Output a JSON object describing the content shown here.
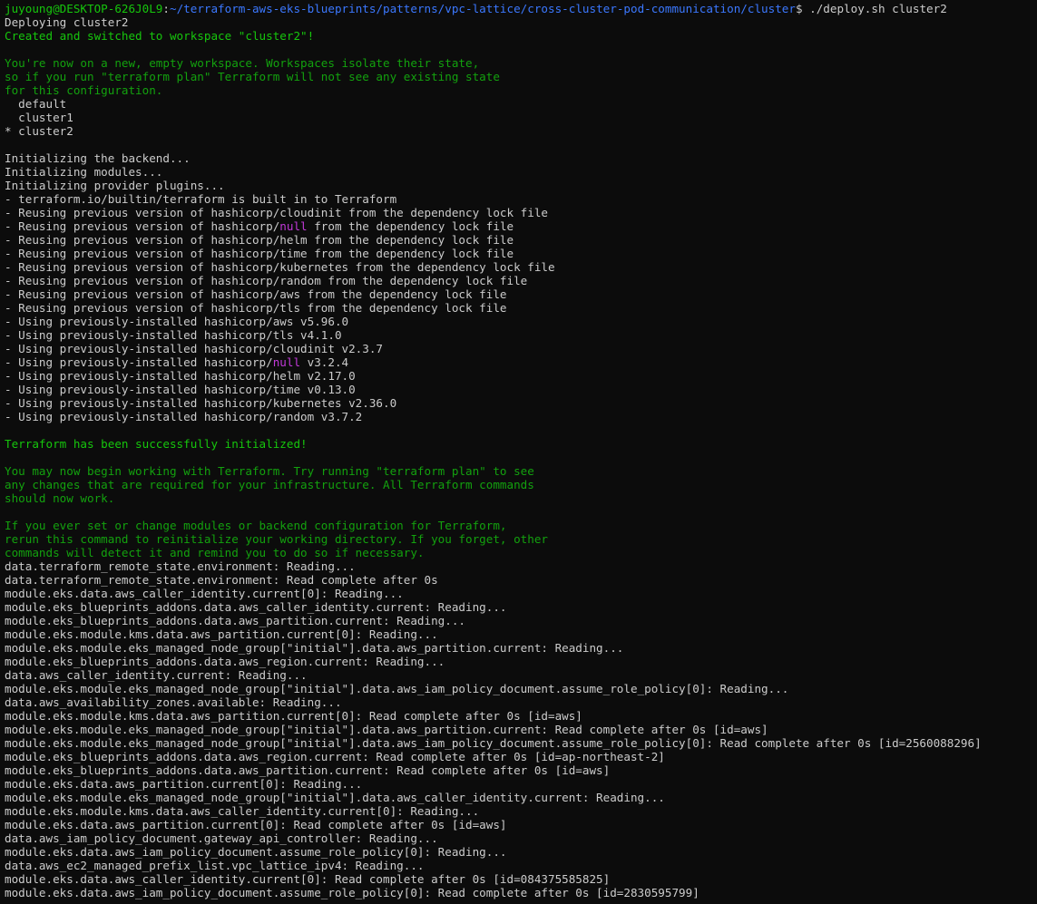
{
  "colors": {
    "background": "#0c0c0c",
    "default": "#cccccc",
    "prompt_user": "#16c60c",
    "prompt_path": "#3b78ff",
    "green": "#13a10e",
    "magenta": "#c239d9",
    "bright_green": "#16c60c"
  },
  "lines": [
    [
      {
        "t": "juyoung@DESKTOP-626J0L9",
        "c": "prompt_user"
      },
      {
        "t": ":",
        "c": "default"
      },
      {
        "t": "~/terraform-aws-eks-blueprints/patterns/vpc-lattice/cross-cluster-pod-communication/cluster",
        "c": "prompt_path"
      },
      {
        "t": "$ ./deploy.sh cluster2",
        "c": "default"
      }
    ],
    [
      {
        "t": "Deploying cluster2",
        "c": "default"
      }
    ],
    [
      {
        "t": "Created and switched to workspace \"cluster2\"!",
        "c": "bright_green"
      }
    ],
    [
      {
        "t": "",
        "c": "default"
      }
    ],
    [
      {
        "t": "You're now on a new, empty workspace. Workspaces isolate their state,",
        "c": "green"
      }
    ],
    [
      {
        "t": "so if you run \"terraform plan\" Terraform will not see any existing state",
        "c": "green"
      }
    ],
    [
      {
        "t": "for this configuration.",
        "c": "green"
      }
    ],
    [
      {
        "t": "  default",
        "c": "default"
      }
    ],
    [
      {
        "t": "  cluster1",
        "c": "default"
      }
    ],
    [
      {
        "t": "* cluster2",
        "c": "default"
      }
    ],
    [
      {
        "t": "",
        "c": "default"
      }
    ],
    [
      {
        "t": "Initializing the backend...",
        "c": "default"
      }
    ],
    [
      {
        "t": "Initializing modules...",
        "c": "default"
      }
    ],
    [
      {
        "t": "Initializing provider plugins...",
        "c": "default"
      }
    ],
    [
      {
        "t": "- terraform.io/builtin/terraform is built in to Terraform",
        "c": "default"
      }
    ],
    [
      {
        "t": "- Reusing previous version of hashicorp/cloudinit from the dependency lock file",
        "c": "default"
      }
    ],
    [
      {
        "t": "- Reusing previous version of hashicorp/",
        "c": "default"
      },
      {
        "t": "null",
        "c": "magenta"
      },
      {
        "t": " from the dependency lock file",
        "c": "default"
      }
    ],
    [
      {
        "t": "- Reusing previous version of hashicorp/helm from the dependency lock file",
        "c": "default"
      }
    ],
    [
      {
        "t": "- Reusing previous version of hashicorp/time from the dependency lock file",
        "c": "default"
      }
    ],
    [
      {
        "t": "- Reusing previous version of hashicorp/kubernetes from the dependency lock file",
        "c": "default"
      }
    ],
    [
      {
        "t": "- Reusing previous version of hashicorp/random from the dependency lock file",
        "c": "default"
      }
    ],
    [
      {
        "t": "- Reusing previous version of hashicorp/aws from the dependency lock file",
        "c": "default"
      }
    ],
    [
      {
        "t": "- Reusing previous version of hashicorp/tls from the dependency lock file",
        "c": "default"
      }
    ],
    [
      {
        "t": "- Using previously-installed hashicorp/aws v5.96.0",
        "c": "default"
      }
    ],
    [
      {
        "t": "- Using previously-installed hashicorp/tls v4.1.0",
        "c": "default"
      }
    ],
    [
      {
        "t": "- Using previously-installed hashicorp/cloudinit v2.3.7",
        "c": "default"
      }
    ],
    [
      {
        "t": "- Using previously-installed hashicorp/",
        "c": "default"
      },
      {
        "t": "null",
        "c": "magenta"
      },
      {
        "t": " v3.2.4",
        "c": "default"
      }
    ],
    [
      {
        "t": "- Using previously-installed hashicorp/helm v2.17.0",
        "c": "default"
      }
    ],
    [
      {
        "t": "- Using previously-installed hashicorp/time v0.13.0",
        "c": "default"
      }
    ],
    [
      {
        "t": "- Using previously-installed hashicorp/kubernetes v2.36.0",
        "c": "default"
      }
    ],
    [
      {
        "t": "- Using previously-installed hashicorp/random v3.7.2",
        "c": "default"
      }
    ],
    [
      {
        "t": "",
        "c": "default"
      }
    ],
    [
      {
        "t": "Terraform has been successfully initialized!",
        "c": "bright_green"
      }
    ],
    [
      {
        "t": "",
        "c": "default"
      }
    ],
    [
      {
        "t": "You may now begin working with Terraform. Try running \"terraform plan\" to see",
        "c": "green"
      }
    ],
    [
      {
        "t": "any changes that are required for your infrastructure. All Terraform commands",
        "c": "green"
      }
    ],
    [
      {
        "t": "should now work.",
        "c": "green"
      }
    ],
    [
      {
        "t": "",
        "c": "default"
      }
    ],
    [
      {
        "t": "If you ever set or change modules or backend configuration for Terraform,",
        "c": "green"
      }
    ],
    [
      {
        "t": "rerun this command to reinitialize your working directory. If you forget, other",
        "c": "green"
      }
    ],
    [
      {
        "t": "commands will detect it and remind you to do so if necessary.",
        "c": "green"
      }
    ],
    [
      {
        "t": "data.terraform_remote_state.environment: Reading...",
        "c": "default"
      }
    ],
    [
      {
        "t": "data.terraform_remote_state.environment: Read complete after 0s",
        "c": "default"
      }
    ],
    [
      {
        "t": "module.eks.data.aws_caller_identity.current[0]: Reading...",
        "c": "default"
      }
    ],
    [
      {
        "t": "module.eks_blueprints_addons.data.aws_caller_identity.current: Reading...",
        "c": "default"
      }
    ],
    [
      {
        "t": "module.eks_blueprints_addons.data.aws_partition.current: Reading...",
        "c": "default"
      }
    ],
    [
      {
        "t": "module.eks.module.kms.data.aws_partition.current[0]: Reading...",
        "c": "default"
      }
    ],
    [
      {
        "t": "module.eks.module.eks_managed_node_group[\"initial\"].data.aws_partition.current: Reading...",
        "c": "default"
      }
    ],
    [
      {
        "t": "module.eks_blueprints_addons.data.aws_region.current: Reading...",
        "c": "default"
      }
    ],
    [
      {
        "t": "data.aws_caller_identity.current: Reading...",
        "c": "default"
      }
    ],
    [
      {
        "t": "module.eks.module.eks_managed_node_group[\"initial\"].data.aws_iam_policy_document.assume_role_policy[0]: Reading...",
        "c": "default"
      }
    ],
    [
      {
        "t": "data.aws_availability_zones.available: Reading...",
        "c": "default"
      }
    ],
    [
      {
        "t": "module.eks.module.kms.data.aws_partition.current[0]: Read complete after 0s [id=aws]",
        "c": "default"
      }
    ],
    [
      {
        "t": "module.eks.module.eks_managed_node_group[\"initial\"].data.aws_partition.current: Read complete after 0s [id=aws]",
        "c": "default"
      }
    ],
    [
      {
        "t": "module.eks.module.eks_managed_node_group[\"initial\"].data.aws_iam_policy_document.assume_role_policy[0]: Read complete after 0s [id=2560088296]",
        "c": "default"
      }
    ],
    [
      {
        "t": "module.eks_blueprints_addons.data.aws_region.current: Read complete after 0s [id=ap-northeast-2]",
        "c": "default"
      }
    ],
    [
      {
        "t": "module.eks_blueprints_addons.data.aws_partition.current: Read complete after 0s [id=aws]",
        "c": "default"
      }
    ],
    [
      {
        "t": "module.eks.data.aws_partition.current[0]: Reading...",
        "c": "default"
      }
    ],
    [
      {
        "t": "module.eks.module.eks_managed_node_group[\"initial\"].data.aws_caller_identity.current: Reading...",
        "c": "default"
      }
    ],
    [
      {
        "t": "module.eks.module.kms.data.aws_caller_identity.current[0]: Reading...",
        "c": "default"
      }
    ],
    [
      {
        "t": "module.eks.data.aws_partition.current[0]: Read complete after 0s [id=aws]",
        "c": "default"
      }
    ],
    [
      {
        "t": "data.aws_iam_policy_document.gateway_api_controller: Reading...",
        "c": "default"
      }
    ],
    [
      {
        "t": "module.eks.data.aws_iam_policy_document.assume_role_policy[0]: Reading...",
        "c": "default"
      }
    ],
    [
      {
        "t": "data.aws_ec2_managed_prefix_list.vpc_lattice_ipv4: Reading...",
        "c": "default"
      }
    ],
    [
      {
        "t": "module.eks.data.aws_caller_identity.current[0]: Read complete after 0s [id=084375585825]",
        "c": "default"
      }
    ],
    [
      {
        "t": "module.eks.data.aws_iam_policy_document.assume_role_policy[0]: Read complete after 0s [id=2830595799]",
        "c": "default"
      }
    ]
  ]
}
